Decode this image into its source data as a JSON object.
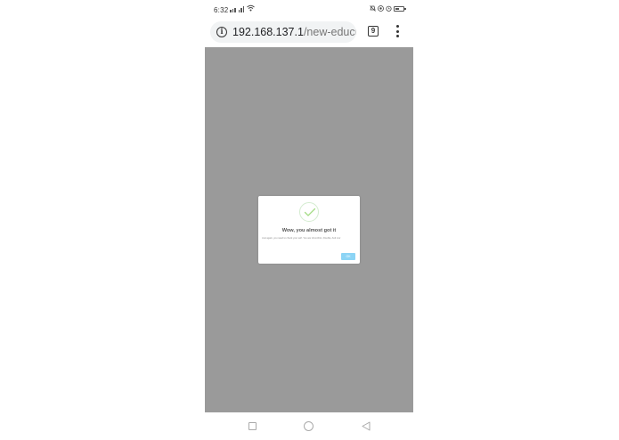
{
  "status_bar": {
    "time": "6:32",
    "wifi_icon": "wifi-icon",
    "right_icons": [
      "mute-icon",
      "location-icon",
      "alarm-icon",
      "battery-icon"
    ]
  },
  "address_bar": {
    "url_host": "192.168.137.1",
    "url_path": "/new-educMine",
    "tab_count": "9"
  },
  "dialog": {
    "icon": "check-icon",
    "title": "Wow, you almost got it",
    "body": "Just again, you need to check your self. You are Unconfrim, Double, And mor",
    "ok_label": "OK"
  },
  "colors": {
    "overlay": "#9a9a9a",
    "ok_button": "#8cd4f5",
    "check": "#a5dc86"
  }
}
